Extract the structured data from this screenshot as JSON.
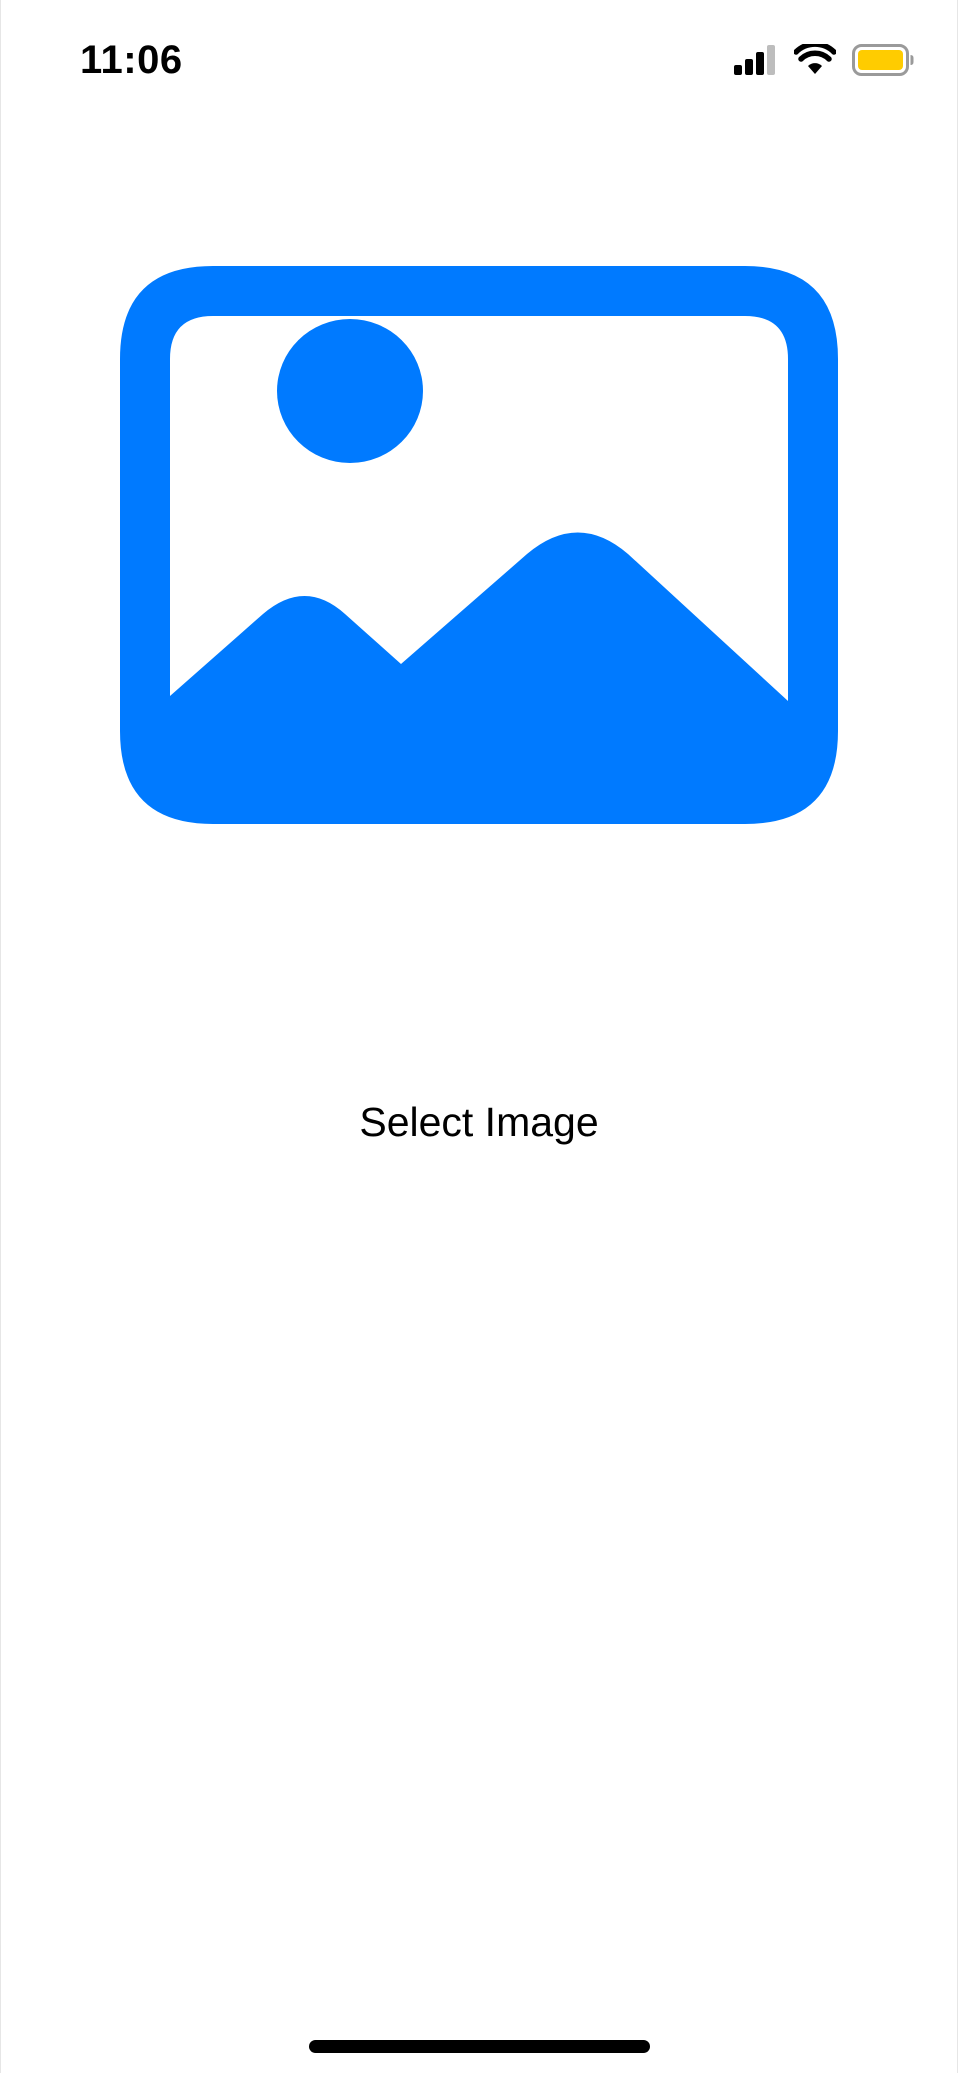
{
  "status_bar": {
    "time": "11:06",
    "icons": [
      "cellular-signal-icon",
      "wifi-icon",
      "battery-icon"
    ],
    "battery_color": "#FFCC00"
  },
  "main": {
    "hero_icon": "photo-icon",
    "accent_color": "#007AFF",
    "select_button_label": "Select Image"
  }
}
